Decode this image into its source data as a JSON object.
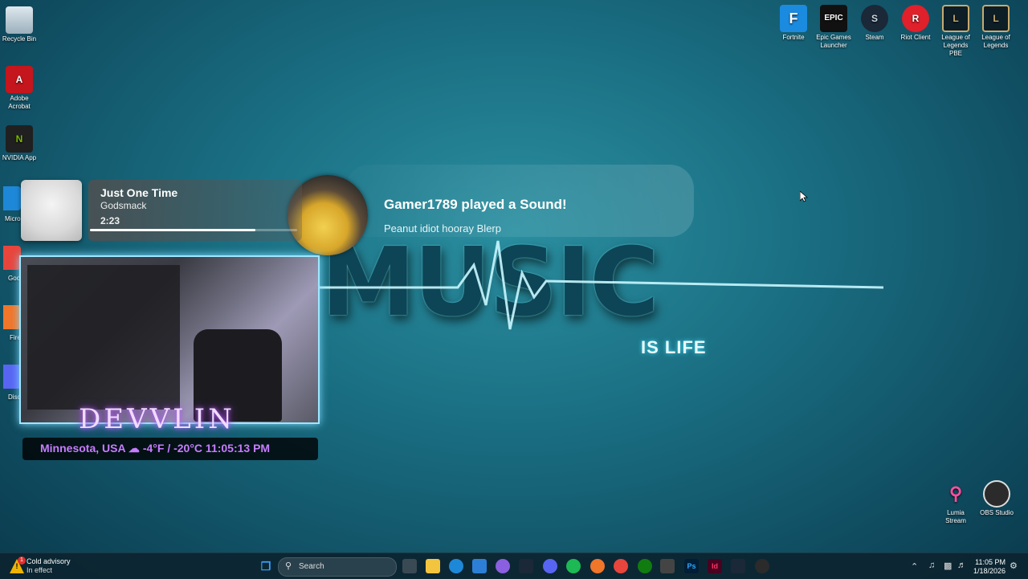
{
  "desktop_left": [
    {
      "label": "Recycle Bin",
      "icon": "recycle-bin-icon"
    },
    {
      "label": "Adobe Acrobat",
      "icon": "acrobat-icon"
    },
    {
      "label": "NVIDIA App",
      "icon": "nvidia-icon"
    }
  ],
  "desktop_left_partial": [
    "Micro Edg",
    "Goo Chr",
    "Fire",
    "Disc"
  ],
  "desktop_right": [
    {
      "label": "Fortnite",
      "icon": "fortnite-icon",
      "glyph": "F",
      "color": "#1b8be0"
    },
    {
      "label": "Epic Games Launcher",
      "icon": "epic-games-icon",
      "glyph": "EPIC",
      "color": "#111111"
    },
    {
      "label": "Steam",
      "icon": "steam-icon",
      "glyph": "S",
      "color": "#1b2838"
    },
    {
      "label": "Riot Client",
      "icon": "riot-client-icon",
      "glyph": "R",
      "color": "#e0202a"
    },
    {
      "label": "League of Legends PBE",
      "icon": "league-pbe-icon",
      "glyph": "L",
      "color": "#0d1e26"
    },
    {
      "label": "League of Legends",
      "icon": "league-icon",
      "glyph": "L",
      "color": "#0d1e26"
    }
  ],
  "desktop_bottom_right": [
    {
      "label": "Lumia Stream",
      "icon": "lumia-stream-icon"
    },
    {
      "label": "OBS Studio",
      "icon": "obs-studio-icon"
    }
  ],
  "wallpaper": {
    "big_text": "MUSIC",
    "sub_text": "IS LIFE"
  },
  "now_playing": {
    "title": "Just One Time",
    "artist": "Godsmack",
    "time": "2:23",
    "progress": 0.8
  },
  "alert": {
    "title": "Gamer1789 played a Sound!",
    "message": "Peanut idiot hooray Blerp"
  },
  "streamer": {
    "name": "DEVVLIN",
    "info": "Minnesota, USA ☁ -4°F / -20°C  11:05:13 PM"
  },
  "taskbar": {
    "weather_title": "Cold advisory",
    "weather_sub": "In effect",
    "weather_badge": "1",
    "search_placeholder": "Search",
    "clock_time": "11:05 PM",
    "clock_date": "1/18/2026"
  },
  "colors": {
    "accent": "#c77dff",
    "webcam_border": "#9ee7ff"
  }
}
